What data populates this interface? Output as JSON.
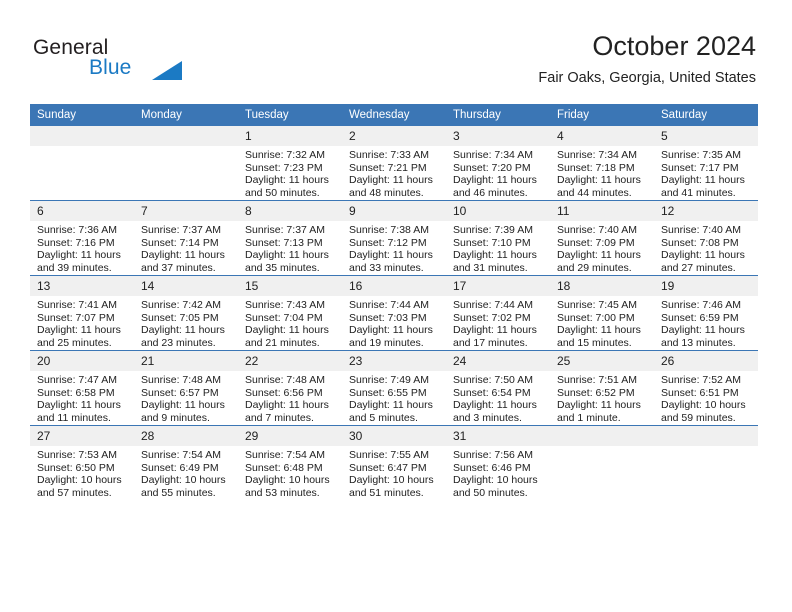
{
  "brand": {
    "name_part1": "General",
    "name_part2": "Blue",
    "logo_color": "#1b7ac4"
  },
  "header": {
    "title": "October 2024",
    "location": "Fair Oaks, Georgia, United States"
  },
  "theme": {
    "header_row_bg": "#3b76b5",
    "date_band_bg": "#f0f0f0",
    "separator": "#3b76b5",
    "text": "#222222"
  },
  "weekday_headers": [
    "Sunday",
    "Monday",
    "Tuesday",
    "Wednesday",
    "Thursday",
    "Friday",
    "Saturday"
  ],
  "labels": {
    "sunrise_prefix": "Sunrise:",
    "sunset_prefix": "Sunset:",
    "daylight_prefix": "Daylight:"
  },
  "weeks": [
    [
      {
        "day": "",
        "blank": true,
        "sunrise": "",
        "sunset": "",
        "daylight_line1": "",
        "daylight_line2": ""
      },
      {
        "day": "",
        "blank": true,
        "sunrise": "",
        "sunset": "",
        "daylight_line1": "",
        "daylight_line2": ""
      },
      {
        "day": "1",
        "blank": false,
        "sunrise": "Sunrise: 7:32 AM",
        "sunset": "Sunset: 7:23 PM",
        "daylight_line1": "Daylight: 11 hours",
        "daylight_line2": "and 50 minutes."
      },
      {
        "day": "2",
        "blank": false,
        "sunrise": "Sunrise: 7:33 AM",
        "sunset": "Sunset: 7:21 PM",
        "daylight_line1": "Daylight: 11 hours",
        "daylight_line2": "and 48 minutes."
      },
      {
        "day": "3",
        "blank": false,
        "sunrise": "Sunrise: 7:34 AM",
        "sunset": "Sunset: 7:20 PM",
        "daylight_line1": "Daylight: 11 hours",
        "daylight_line2": "and 46 minutes."
      },
      {
        "day": "4",
        "blank": false,
        "sunrise": "Sunrise: 7:34 AM",
        "sunset": "Sunset: 7:18 PM",
        "daylight_line1": "Daylight: 11 hours",
        "daylight_line2": "and 44 minutes."
      },
      {
        "day": "5",
        "blank": false,
        "sunrise": "Sunrise: 7:35 AM",
        "sunset": "Sunset: 7:17 PM",
        "daylight_line1": "Daylight: 11 hours",
        "daylight_line2": "and 41 minutes."
      }
    ],
    [
      {
        "day": "6",
        "blank": false,
        "sunrise": "Sunrise: 7:36 AM",
        "sunset": "Sunset: 7:16 PM",
        "daylight_line1": "Daylight: 11 hours",
        "daylight_line2": "and 39 minutes."
      },
      {
        "day": "7",
        "blank": false,
        "sunrise": "Sunrise: 7:37 AM",
        "sunset": "Sunset: 7:14 PM",
        "daylight_line1": "Daylight: 11 hours",
        "daylight_line2": "and 37 minutes."
      },
      {
        "day": "8",
        "blank": false,
        "sunrise": "Sunrise: 7:37 AM",
        "sunset": "Sunset: 7:13 PM",
        "daylight_line1": "Daylight: 11 hours",
        "daylight_line2": "and 35 minutes."
      },
      {
        "day": "9",
        "blank": false,
        "sunrise": "Sunrise: 7:38 AM",
        "sunset": "Sunset: 7:12 PM",
        "daylight_line1": "Daylight: 11 hours",
        "daylight_line2": "and 33 minutes."
      },
      {
        "day": "10",
        "blank": false,
        "sunrise": "Sunrise: 7:39 AM",
        "sunset": "Sunset: 7:10 PM",
        "daylight_line1": "Daylight: 11 hours",
        "daylight_line2": "and 31 minutes."
      },
      {
        "day": "11",
        "blank": false,
        "sunrise": "Sunrise: 7:40 AM",
        "sunset": "Sunset: 7:09 PM",
        "daylight_line1": "Daylight: 11 hours",
        "daylight_line2": "and 29 minutes."
      },
      {
        "day": "12",
        "blank": false,
        "sunrise": "Sunrise: 7:40 AM",
        "sunset": "Sunset: 7:08 PM",
        "daylight_line1": "Daylight: 11 hours",
        "daylight_line2": "and 27 minutes."
      }
    ],
    [
      {
        "day": "13",
        "blank": false,
        "sunrise": "Sunrise: 7:41 AM",
        "sunset": "Sunset: 7:07 PM",
        "daylight_line1": "Daylight: 11 hours",
        "daylight_line2": "and 25 minutes."
      },
      {
        "day": "14",
        "blank": false,
        "sunrise": "Sunrise: 7:42 AM",
        "sunset": "Sunset: 7:05 PM",
        "daylight_line1": "Daylight: 11 hours",
        "daylight_line2": "and 23 minutes."
      },
      {
        "day": "15",
        "blank": false,
        "sunrise": "Sunrise: 7:43 AM",
        "sunset": "Sunset: 7:04 PM",
        "daylight_line1": "Daylight: 11 hours",
        "daylight_line2": "and 21 minutes."
      },
      {
        "day": "16",
        "blank": false,
        "sunrise": "Sunrise: 7:44 AM",
        "sunset": "Sunset: 7:03 PM",
        "daylight_line1": "Daylight: 11 hours",
        "daylight_line2": "and 19 minutes."
      },
      {
        "day": "17",
        "blank": false,
        "sunrise": "Sunrise: 7:44 AM",
        "sunset": "Sunset: 7:02 PM",
        "daylight_line1": "Daylight: 11 hours",
        "daylight_line2": "and 17 minutes."
      },
      {
        "day": "18",
        "blank": false,
        "sunrise": "Sunrise: 7:45 AM",
        "sunset": "Sunset: 7:00 PM",
        "daylight_line1": "Daylight: 11 hours",
        "daylight_line2": "and 15 minutes."
      },
      {
        "day": "19",
        "blank": false,
        "sunrise": "Sunrise: 7:46 AM",
        "sunset": "Sunset: 6:59 PM",
        "daylight_line1": "Daylight: 11 hours",
        "daylight_line2": "and 13 minutes."
      }
    ],
    [
      {
        "day": "20",
        "blank": false,
        "sunrise": "Sunrise: 7:47 AM",
        "sunset": "Sunset: 6:58 PM",
        "daylight_line1": "Daylight: 11 hours",
        "daylight_line2": "and 11 minutes."
      },
      {
        "day": "21",
        "blank": false,
        "sunrise": "Sunrise: 7:48 AM",
        "sunset": "Sunset: 6:57 PM",
        "daylight_line1": "Daylight: 11 hours",
        "daylight_line2": "and 9 minutes."
      },
      {
        "day": "22",
        "blank": false,
        "sunrise": "Sunrise: 7:48 AM",
        "sunset": "Sunset: 6:56 PM",
        "daylight_line1": "Daylight: 11 hours",
        "daylight_line2": "and 7 minutes."
      },
      {
        "day": "23",
        "blank": false,
        "sunrise": "Sunrise: 7:49 AM",
        "sunset": "Sunset: 6:55 PM",
        "daylight_line1": "Daylight: 11 hours",
        "daylight_line2": "and 5 minutes."
      },
      {
        "day": "24",
        "blank": false,
        "sunrise": "Sunrise: 7:50 AM",
        "sunset": "Sunset: 6:54 PM",
        "daylight_line1": "Daylight: 11 hours",
        "daylight_line2": "and 3 minutes."
      },
      {
        "day": "25",
        "blank": false,
        "sunrise": "Sunrise: 7:51 AM",
        "sunset": "Sunset: 6:52 PM",
        "daylight_line1": "Daylight: 11 hours",
        "daylight_line2": "and 1 minute."
      },
      {
        "day": "26",
        "blank": false,
        "sunrise": "Sunrise: 7:52 AM",
        "sunset": "Sunset: 6:51 PM",
        "daylight_line1": "Daylight: 10 hours",
        "daylight_line2": "and 59 minutes."
      }
    ],
    [
      {
        "day": "27",
        "blank": false,
        "sunrise": "Sunrise: 7:53 AM",
        "sunset": "Sunset: 6:50 PM",
        "daylight_line1": "Daylight: 10 hours",
        "daylight_line2": "and 57 minutes."
      },
      {
        "day": "28",
        "blank": false,
        "sunrise": "Sunrise: 7:54 AM",
        "sunset": "Sunset: 6:49 PM",
        "daylight_line1": "Daylight: 10 hours",
        "daylight_line2": "and 55 minutes."
      },
      {
        "day": "29",
        "blank": false,
        "sunrise": "Sunrise: 7:54 AM",
        "sunset": "Sunset: 6:48 PM",
        "daylight_line1": "Daylight: 10 hours",
        "daylight_line2": "and 53 minutes."
      },
      {
        "day": "30",
        "blank": false,
        "sunrise": "Sunrise: 7:55 AM",
        "sunset": "Sunset: 6:47 PM",
        "daylight_line1": "Daylight: 10 hours",
        "daylight_line2": "and 51 minutes."
      },
      {
        "day": "31",
        "blank": false,
        "sunrise": "Sunrise: 7:56 AM",
        "sunset": "Sunset: 6:46 PM",
        "daylight_line1": "Daylight: 10 hours",
        "daylight_line2": "and 50 minutes."
      },
      {
        "day": "",
        "blank": true,
        "sunrise": "",
        "sunset": "",
        "daylight_line1": "",
        "daylight_line2": ""
      },
      {
        "day": "",
        "blank": true,
        "sunrise": "",
        "sunset": "",
        "daylight_line1": "",
        "daylight_line2": ""
      }
    ]
  ]
}
